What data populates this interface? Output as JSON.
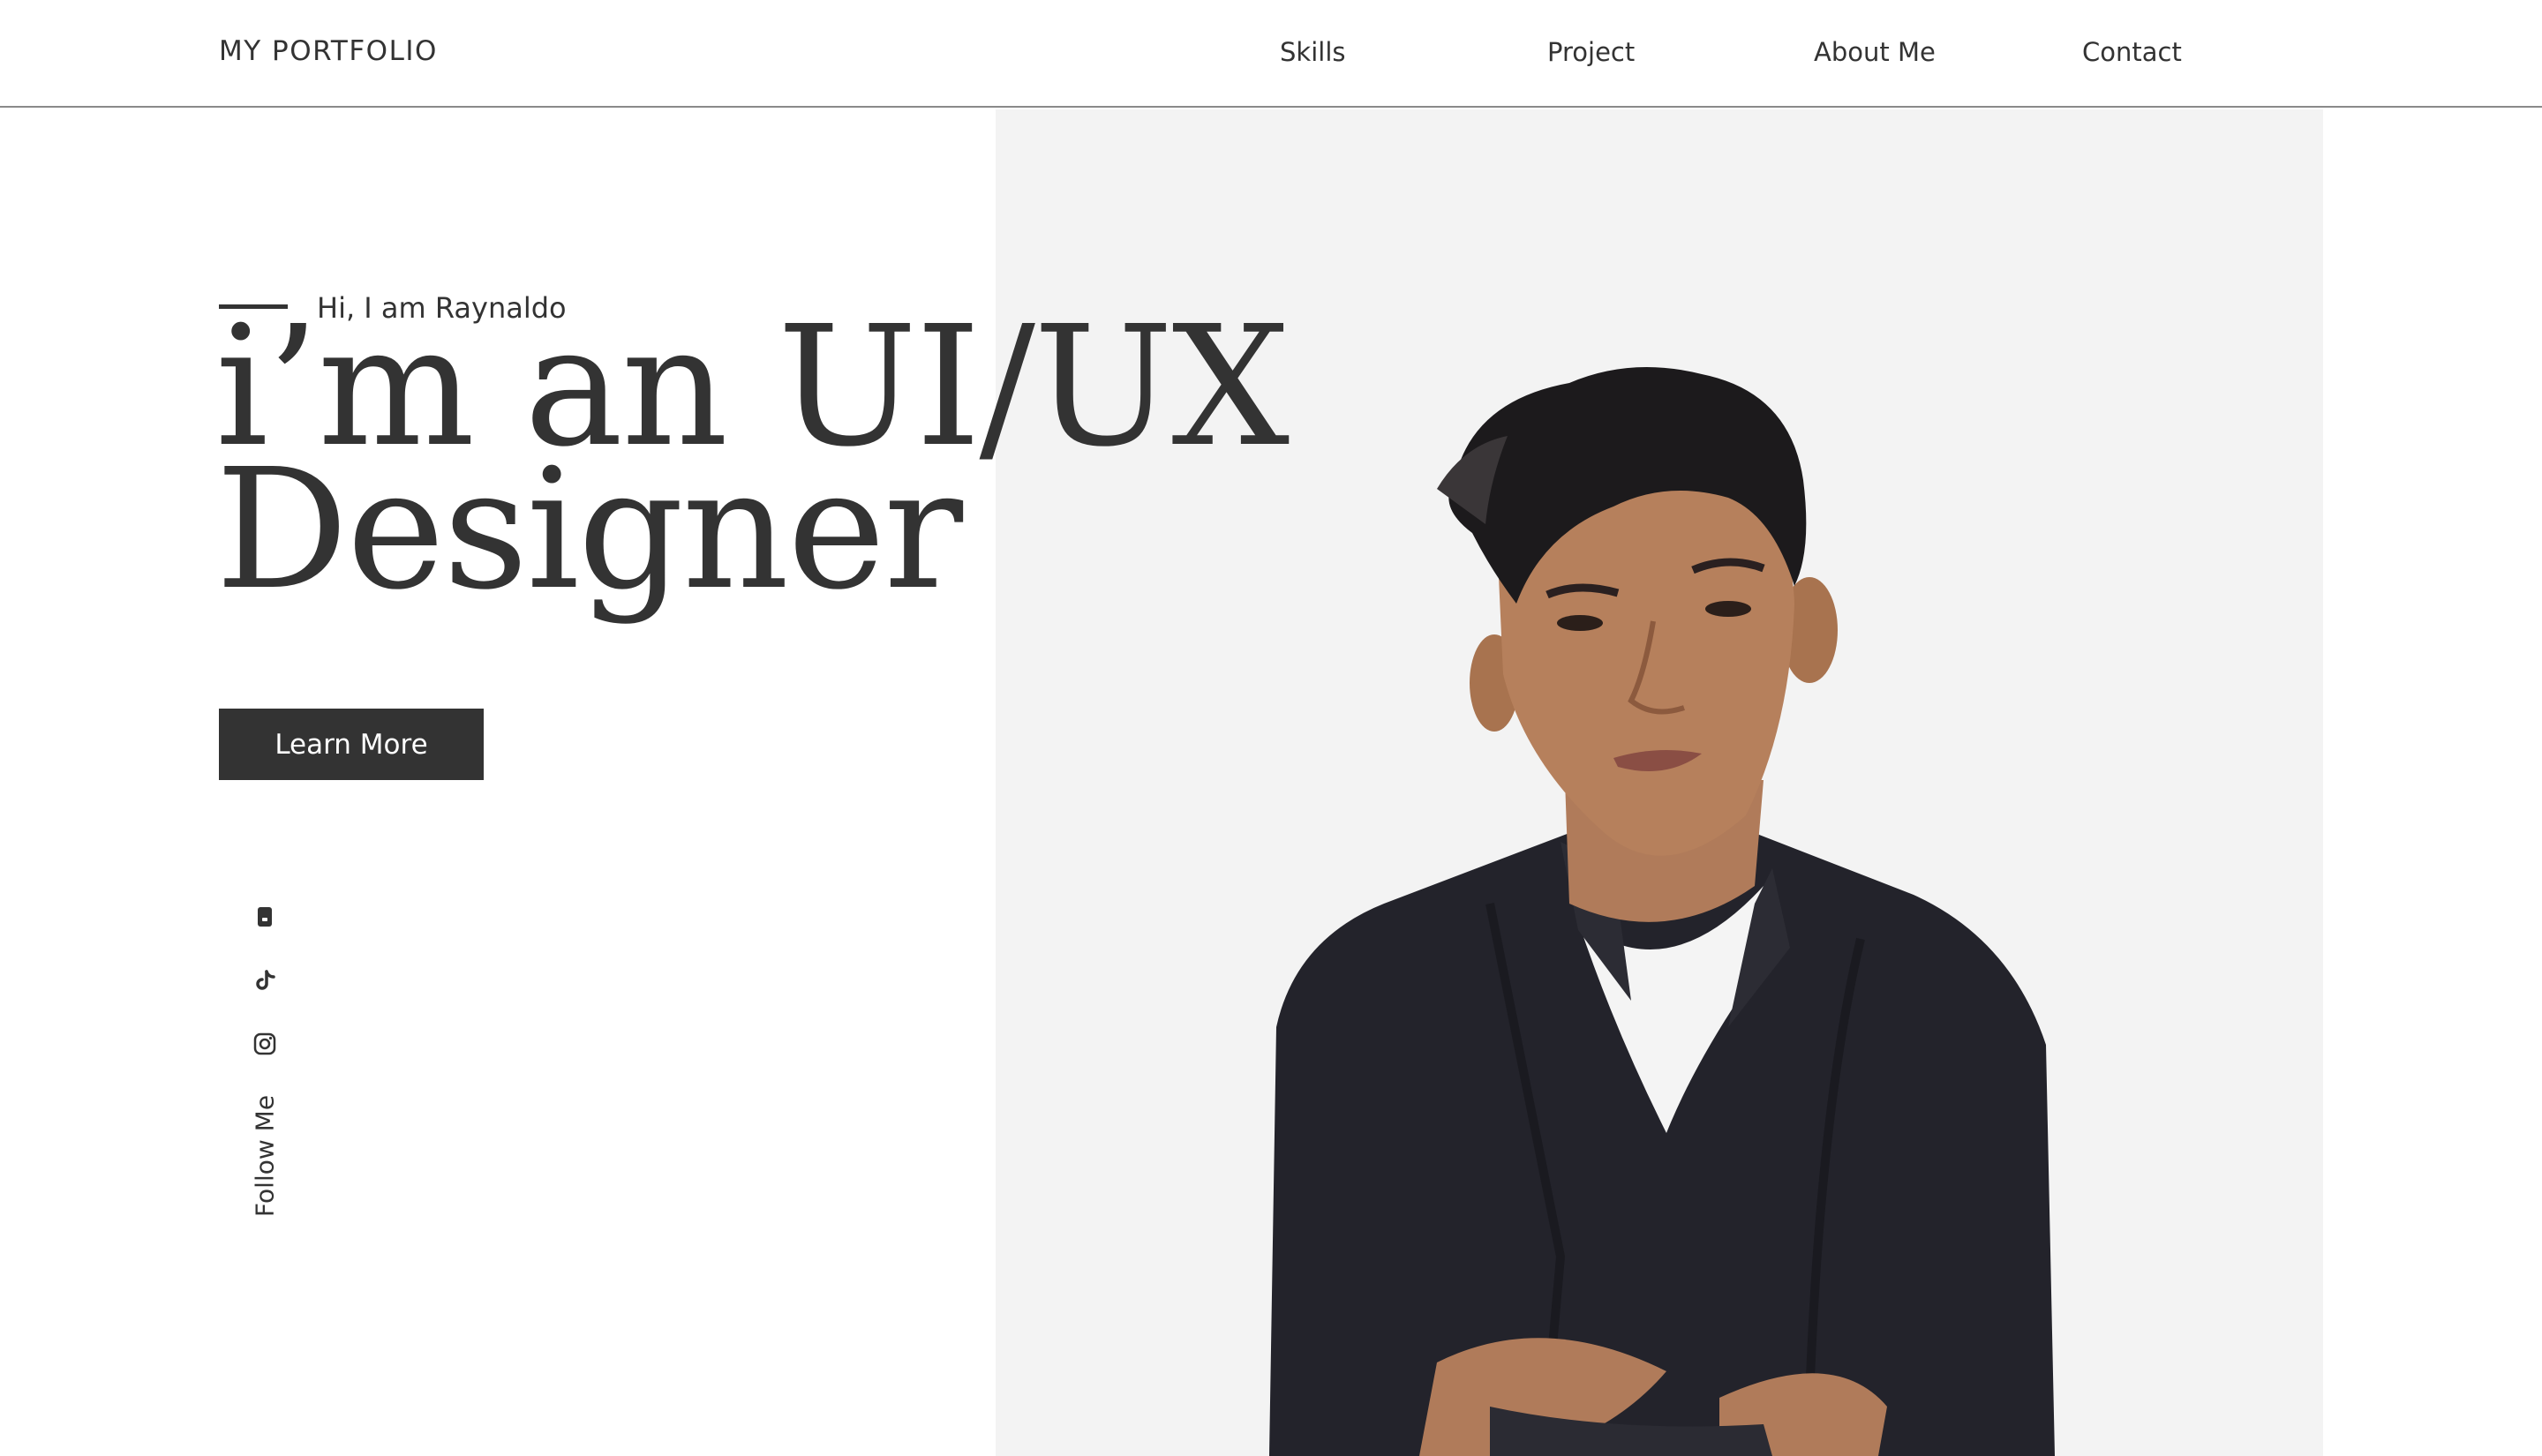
{
  "header": {
    "brand": "MY PORTFOLIO",
    "nav": [
      "Skills",
      "Project",
      "About Me",
      "Contact"
    ]
  },
  "hero": {
    "intro": "Hi, I am Raynaldo",
    "headline_line1": "i’m an UI/UX",
    "headline_line2": "Designer",
    "cta_label": "Learn More"
  },
  "social": {
    "icons": [
      "phone-icon",
      "tiktok-icon",
      "instagram-icon"
    ],
    "follow_label": "Follow Me"
  },
  "colors": {
    "text": "#333333",
    "button_bg": "#333333",
    "button_text": "#ffffff",
    "panel_bg": "#f3f3f3",
    "divider": "#8a8a8a"
  }
}
